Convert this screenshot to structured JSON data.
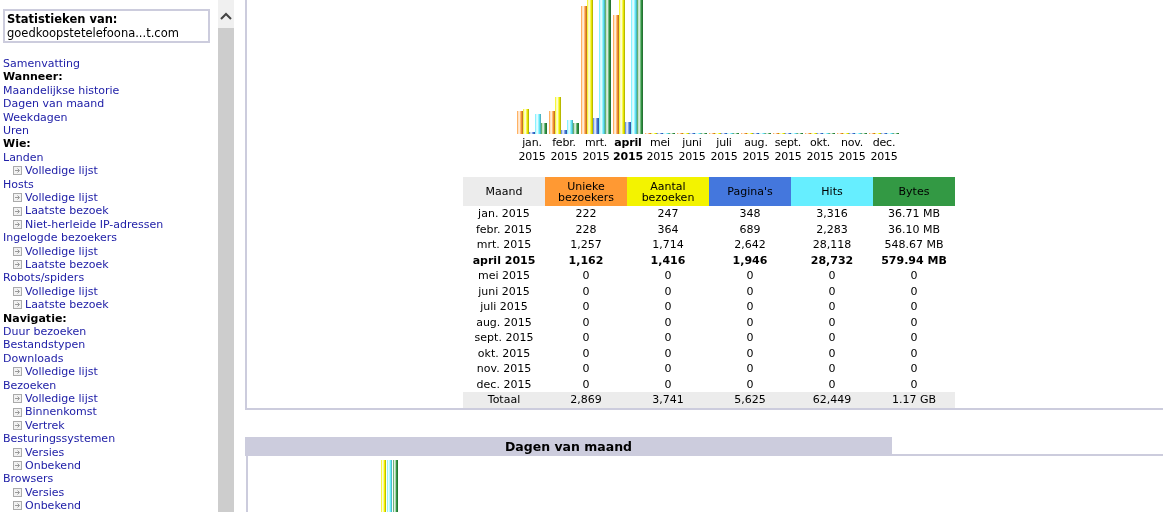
{
  "sidebar": {
    "title": "Statistieken van:",
    "site": "goedkoopstetelefoona...t.com",
    "items": [
      {
        "kind": "link",
        "label": "Samenvatting"
      },
      {
        "kind": "heading",
        "label": "Wanneer:"
      },
      {
        "kind": "link",
        "label": "Maandelijkse historie"
      },
      {
        "kind": "link",
        "label": "Dagen van maand"
      },
      {
        "kind": "link",
        "label": "Weekdagen"
      },
      {
        "kind": "link",
        "label": "Uren"
      },
      {
        "kind": "heading",
        "label": "Wie:"
      },
      {
        "kind": "link",
        "label": "Landen",
        "children": [
          {
            "label": "Volledige lijst"
          }
        ]
      },
      {
        "kind": "link",
        "label": "Hosts",
        "children": [
          {
            "label": "Volledige lijst"
          },
          {
            "label": "Laatste bezoek"
          },
          {
            "label": "Niet-herleide IP-adressen"
          }
        ]
      },
      {
        "kind": "link",
        "label": "Ingelogde bezoekers",
        "children": [
          {
            "label": "Volledige lijst"
          },
          {
            "label": "Laatste bezoek"
          }
        ]
      },
      {
        "kind": "link",
        "label": "Robots/spiders",
        "children": [
          {
            "label": "Volledige lijst"
          },
          {
            "label": "Laatste bezoek"
          }
        ]
      },
      {
        "kind": "heading",
        "label": "Navigatie:"
      },
      {
        "kind": "link",
        "label": "Duur bezoeken"
      },
      {
        "kind": "link",
        "label": "Bestandstypen"
      },
      {
        "kind": "link",
        "label": "Downloads",
        "children": [
          {
            "label": "Volledige lijst"
          }
        ]
      },
      {
        "kind": "link",
        "label": "Bezoeken",
        "children": [
          {
            "label": "Volledige lijst"
          },
          {
            "label": "Binnenkomst"
          },
          {
            "label": "Vertrek"
          }
        ]
      },
      {
        "kind": "link",
        "label": "Besturingssystemen",
        "children": [
          {
            "label": "Versies"
          },
          {
            "label": "Onbekend"
          }
        ]
      },
      {
        "kind": "link",
        "label": "Browsers",
        "children": [
          {
            "label": "Versies"
          },
          {
            "label": "Onbekend"
          }
        ]
      }
    ]
  },
  "monthly_table": {
    "columns": [
      {
        "label": "Maand",
        "color": "#ececec"
      },
      {
        "label": "Unieke bezoekers",
        "color": "#ff9933"
      },
      {
        "label": "Aantal bezoeken",
        "color": "#f3f300"
      },
      {
        "label": "Pagina's",
        "color": "#4477dd"
      },
      {
        "label": "Hits",
        "color": "#66eeff"
      },
      {
        "label": "Bytes",
        "color": "#339944"
      }
    ],
    "rows": [
      {
        "month": "jan.",
        "year": "2015",
        "current": false,
        "cells": [
          "jan. 2015",
          "222",
          "247",
          "348",
          "3,316",
          "36.71 MB"
        ]
      },
      {
        "month": "febr.",
        "year": "2015",
        "current": false,
        "cells": [
          "febr. 2015",
          "228",
          "364",
          "689",
          "2,283",
          "36.10 MB"
        ]
      },
      {
        "month": "mrt.",
        "year": "2015",
        "current": false,
        "cells": [
          "mrt. 2015",
          "1,257",
          "1,714",
          "2,642",
          "28,118",
          "548.67 MB"
        ]
      },
      {
        "month": "april",
        "year": "2015",
        "current": true,
        "cells": [
          "april 2015",
          "1,162",
          "1,416",
          "1,946",
          "28,732",
          "579.94 MB"
        ]
      },
      {
        "month": "mei",
        "year": "2015",
        "current": false,
        "cells": [
          "mei 2015",
          "0",
          "0",
          "0",
          "0",
          "0"
        ]
      },
      {
        "month": "juni",
        "year": "2015",
        "current": false,
        "cells": [
          "juni 2015",
          "0",
          "0",
          "0",
          "0",
          "0"
        ]
      },
      {
        "month": "juli",
        "year": "2015",
        "current": false,
        "cells": [
          "juli 2015",
          "0",
          "0",
          "0",
          "0",
          "0"
        ]
      },
      {
        "month": "aug.",
        "year": "2015",
        "current": false,
        "cells": [
          "aug. 2015",
          "0",
          "0",
          "0",
          "0",
          "0"
        ]
      },
      {
        "month": "sept.",
        "year": "2015",
        "current": false,
        "cells": [
          "sept. 2015",
          "0",
          "0",
          "0",
          "0",
          "0"
        ]
      },
      {
        "month": "okt.",
        "year": "2015",
        "current": false,
        "cells": [
          "okt. 2015",
          "0",
          "0",
          "0",
          "0",
          "0"
        ]
      },
      {
        "month": "nov.",
        "year": "2015",
        "current": false,
        "cells": [
          "nov. 2015",
          "0",
          "0",
          "0",
          "0",
          "0"
        ]
      },
      {
        "month": "dec.",
        "year": "2015",
        "current": false,
        "cells": [
          "dec. 2015",
          "0",
          "0",
          "0",
          "0",
          "0"
        ]
      }
    ],
    "total": [
      "Totaal",
      "2,869",
      "3,741",
      "5,625",
      "62,449",
      "1.17 GB"
    ]
  },
  "days_section": {
    "title": "Dagen van maand"
  }
}
